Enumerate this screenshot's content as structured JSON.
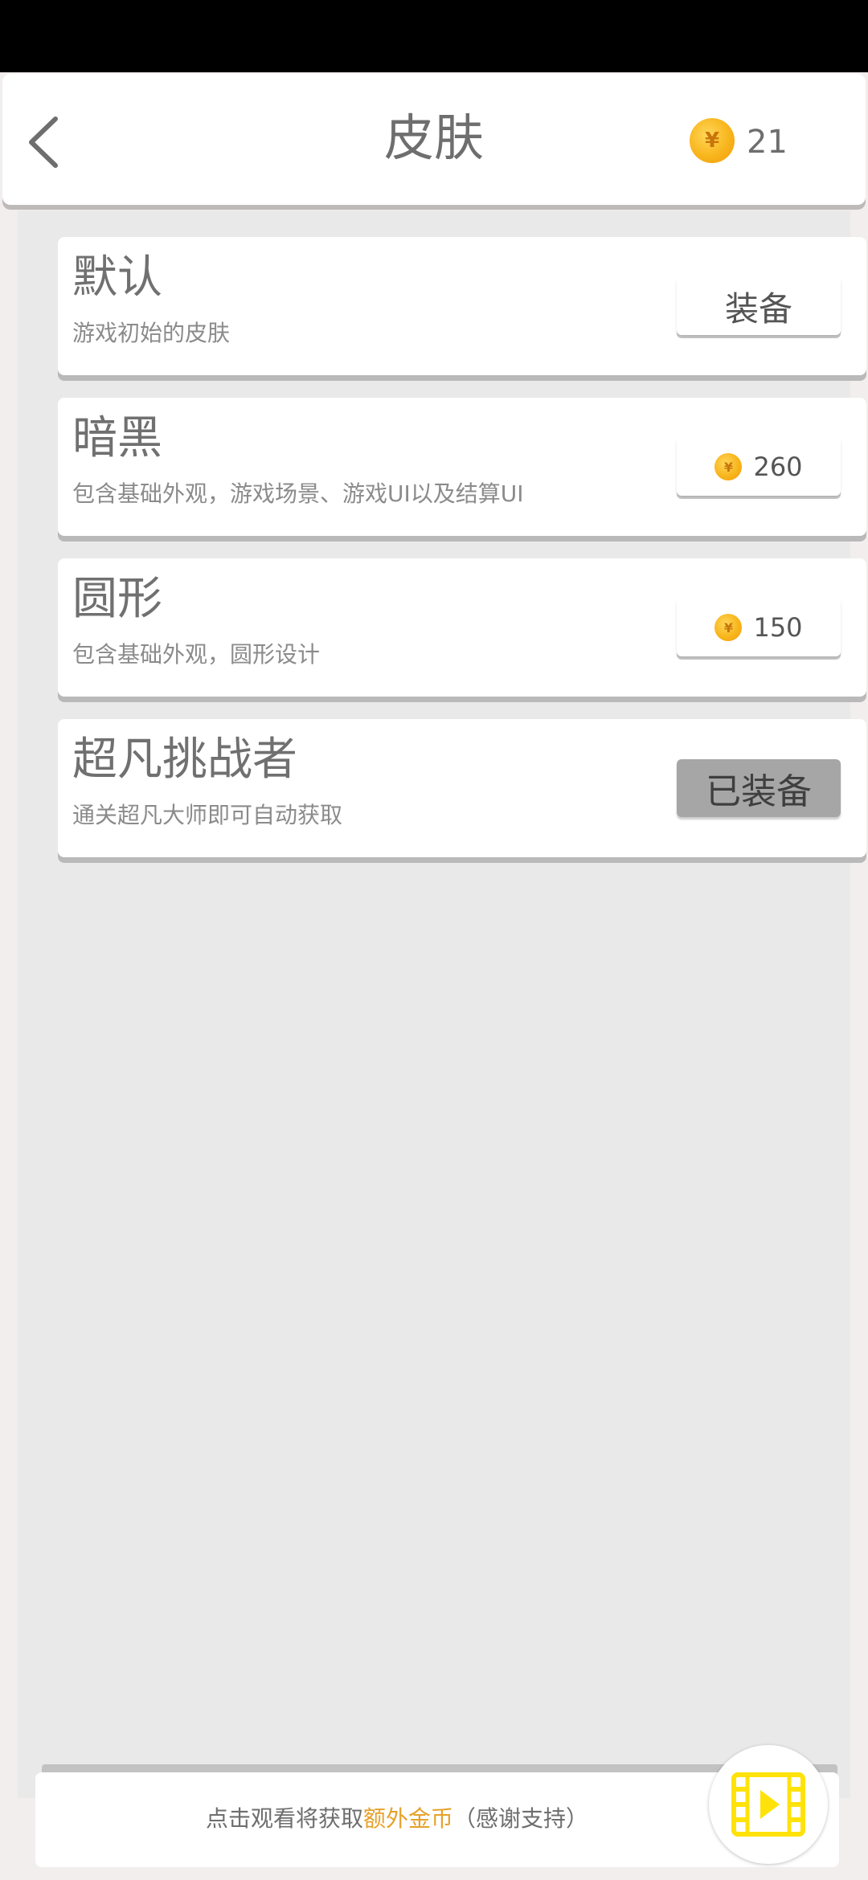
{
  "header": {
    "title": "皮肤",
    "coin_icon": "coin-icon",
    "coin_count": "21"
  },
  "skins": [
    {
      "name": "默认",
      "desc": "游戏初始的皮肤",
      "button_label": "装备"
    },
    {
      "name": "暗黑",
      "desc": "包含基础外观，游戏场景、游戏UI以及结算UI",
      "price": "260"
    },
    {
      "name": "圆形",
      "desc": "包含基础外观，圆形设计",
      "price": "150"
    },
    {
      "name": "超凡挑战者",
      "desc": "通关超凡大师即可自动获取",
      "button_label": "已装备"
    }
  ],
  "bottom": {
    "text_prefix": "点击观看将获取",
    "text_highlight": "额外金币",
    "text_suffix": "（感谢支持）",
    "video_icon": "video-play-icon"
  },
  "colors": {
    "accent_coin": "#f8b51c",
    "highlight_text": "#e6a12a",
    "video_icon": "#ffe20a",
    "equipped_button": "#a6a6a6"
  }
}
